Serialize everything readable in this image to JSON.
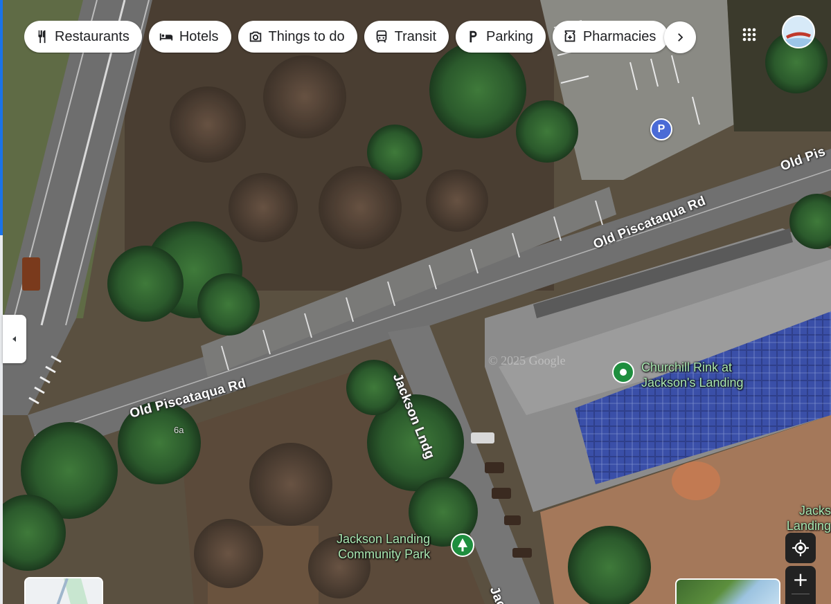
{
  "chips": [
    {
      "label": "Restaurants",
      "icon": "fork-knife-icon"
    },
    {
      "label": "Hotels",
      "icon": "bed-icon"
    },
    {
      "label": "Things to do",
      "icon": "camera-icon"
    },
    {
      "label": "Transit",
      "icon": "train-icon"
    },
    {
      "label": "Parking",
      "icon": "parking-icon"
    },
    {
      "label": "Pharmacies",
      "icon": "pharmacy-icon"
    }
  ],
  "parking_marker": "P",
  "roads": {
    "old_piscataqua_left": "Old Piscataqua Rd",
    "old_piscataqua_mid": "Old Piscataqua Rd",
    "old_piscataqua_right": "Old Pis",
    "jackson_lndg": "Jackson Lndg",
    "jackson_lndg_bottom": "Jack"
  },
  "route_number": "6a",
  "places": {
    "churchill_rink_line1": "Churchill Rink at",
    "churchill_rink_line2": "Jackson's Landing",
    "community_park_line1": "Jackson Landing",
    "community_park_line2": "Community Park",
    "jackson_landing_right_line1": "Jacks",
    "jackson_landing_right_line2": "Landing"
  },
  "watermark": "© 2025 Google",
  "colors": {
    "place_green": "#a8e6b0",
    "pin_green": "#1e8e3e",
    "parking_blue": "#4a6bd6",
    "accent_blue": "#1a73e8"
  }
}
